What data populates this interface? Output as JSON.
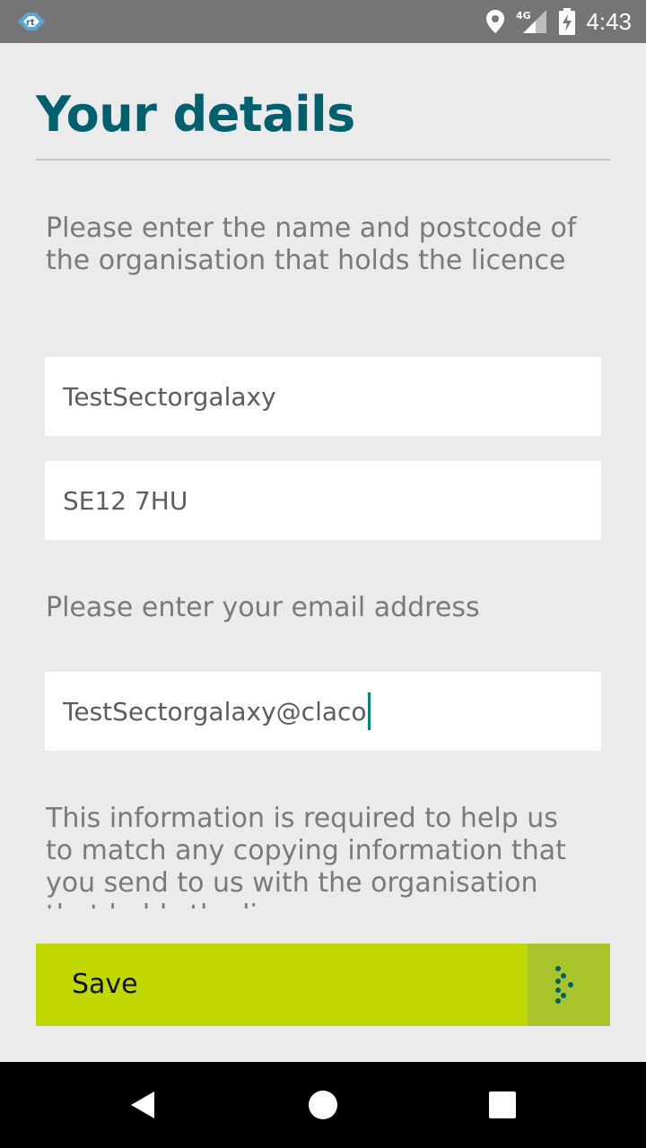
{
  "status_bar": {
    "time": "4:43",
    "network_label": "4G",
    "icons": [
      "app-notification-icon",
      "location-icon",
      "signal-icon",
      "battery-charging-icon"
    ]
  },
  "page": {
    "title": "Your details",
    "intro_text": "Please enter the name and postcode of the organisation that holds the licence",
    "organisation_name_value": "TestSectorgalaxy",
    "postcode_value": "SE12 7HU",
    "email_prompt": "Please enter your email address",
    "email_value": "TestSectorgalaxy@claco",
    "info_text": "This information is required to help us to match any copying information that you send to us with the organisation that holds the licence"
  },
  "save_bar": {
    "label": "Save",
    "arrow_icon": "dotted-arrow-icon"
  },
  "nav_bar": {
    "icons": [
      "back-icon",
      "home-icon",
      "recents-icon"
    ]
  },
  "colors": {
    "title": "#00606e",
    "accent": "#c0d800",
    "caret": "#00897b"
  }
}
